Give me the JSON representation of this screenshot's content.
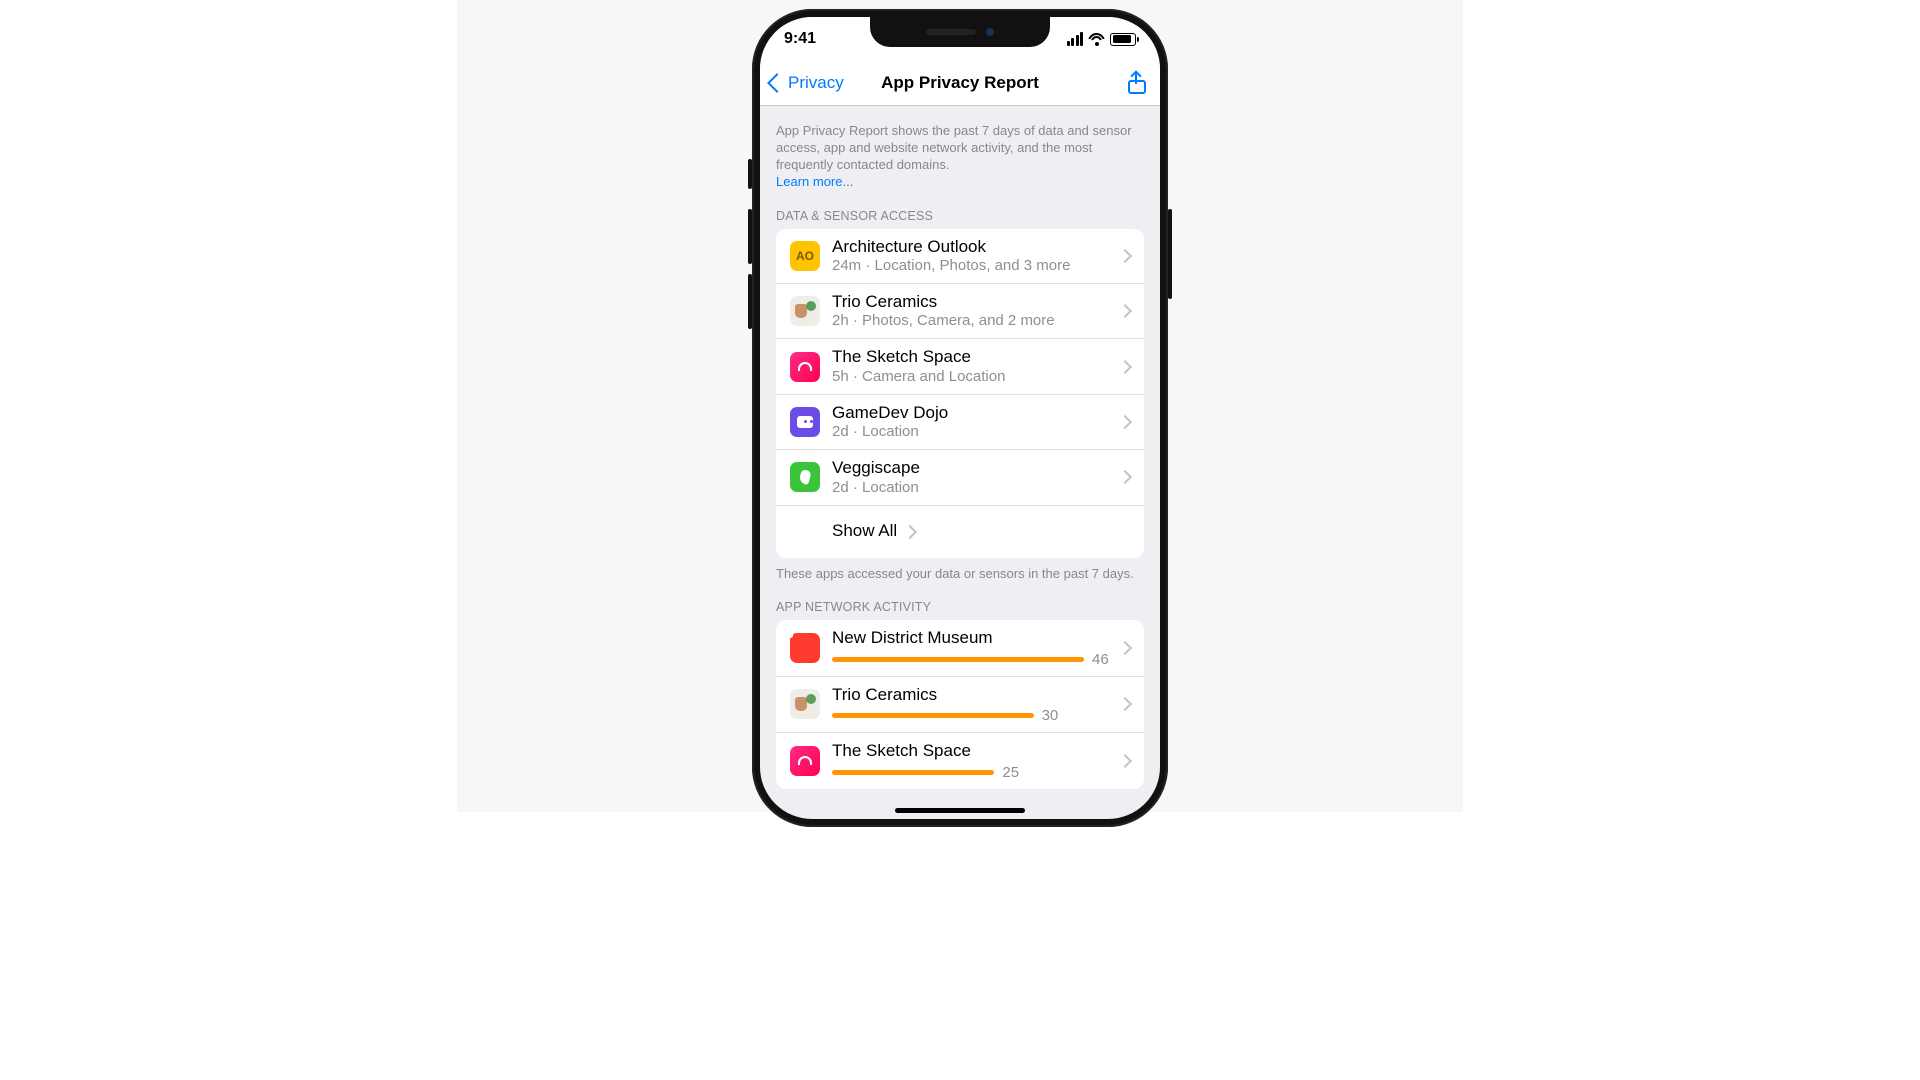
{
  "status": {
    "time": "9:41"
  },
  "nav": {
    "back_label": "Privacy",
    "title": "App Privacy Report"
  },
  "intro": {
    "text": "App Privacy Report shows the past 7 days of data and sensor access, app and website network activity, and the most frequently contacted domains.",
    "learn_more": "Learn more..."
  },
  "data_sensor": {
    "header": "DATA & SENSOR ACCESS",
    "apps": [
      {
        "name": "Architecture Outlook",
        "detail": "24m · Location, Photos, and 3 more"
      },
      {
        "name": "Trio Ceramics",
        "detail": "2h · Photos, Camera, and 2 more"
      },
      {
        "name": "The Sketch Space",
        "detail": "5h · Camera and Location"
      },
      {
        "name": "GameDev Dojo",
        "detail": "2d · Location"
      },
      {
        "name": "Veggiscape",
        "detail": "2d · Location"
      }
    ],
    "show_all": "Show All",
    "footnote": "These apps accessed your data or sensors in the past 7 days."
  },
  "network": {
    "header": "APP NETWORK ACTIVITY",
    "apps": [
      {
        "name": "New District Museum",
        "value": 46,
        "bar_pct": 90
      },
      {
        "name": "Trio Ceramics",
        "value": 30,
        "bar_pct": 72
      },
      {
        "name": "The Sketch Space",
        "value": 25,
        "bar_pct": 58
      }
    ]
  }
}
